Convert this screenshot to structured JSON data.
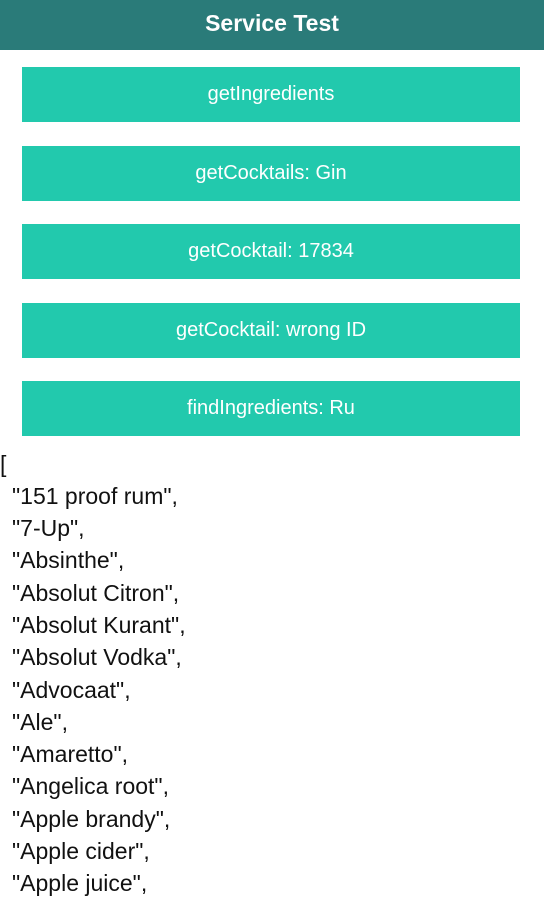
{
  "navbar": {
    "title": "Service Test"
  },
  "buttons": [
    {
      "label": "getIngredients"
    },
    {
      "label": "getCocktails: Gin"
    },
    {
      "label": "getCocktail: 17834"
    },
    {
      "label": "getCocktail: wrong ID"
    },
    {
      "label": "findIngredients: Ru"
    }
  ],
  "output": {
    "open_bracket": "[",
    "items": [
      "\"151 proof rum\",",
      "\"7-Up\",",
      "\"Absinthe\",",
      "\"Absolut Citron\",",
      "\"Absolut Kurant\",",
      "\"Absolut Vodka\",",
      "\"Advocaat\",",
      "\"Ale\",",
      "\"Amaretto\",",
      "\"Angelica root\",",
      "\"Apple brandy\",",
      "\"Apple cider\",",
      "\"Apple juice\","
    ]
  },
  "colors": {
    "navbar_bg": "#2a7b79",
    "button_bg": "#22c9ad",
    "button_text": "#ffffff"
  }
}
